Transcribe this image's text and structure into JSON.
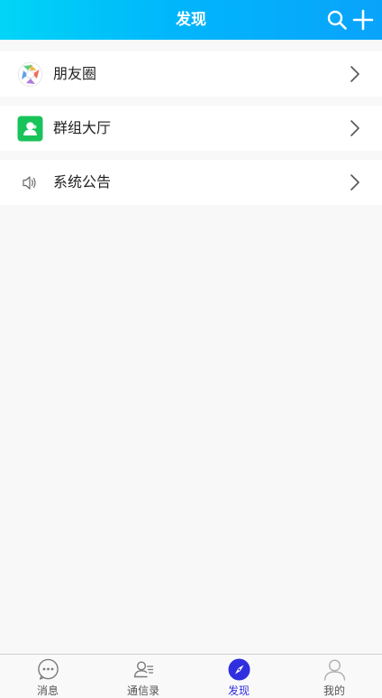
{
  "header": {
    "title": "发现",
    "search_icon": "search-icon",
    "add_icon": "plus-icon",
    "gradient": [
      "#00d5f7",
      "#0aa3fb"
    ]
  },
  "menu": {
    "items": [
      {
        "label": "朋友圈",
        "icon": "moments-aperture-icon"
      },
      {
        "label": "群组大厅",
        "icon": "group-hall-icon",
        "icon_color": "#18c35a"
      },
      {
        "label": "系统公告",
        "icon": "speaker-icon"
      }
    ],
    "chevron_icon": "chevron-right-icon"
  },
  "tabbar": {
    "tabs": [
      {
        "label": "消息",
        "icon": "chat-bubble-icon",
        "active": false
      },
      {
        "label": "通信录",
        "icon": "contacts-icon",
        "active": false
      },
      {
        "label": "发现",
        "icon": "compass-icon",
        "active": true
      },
      {
        "label": "我的",
        "icon": "person-icon",
        "active": false
      }
    ],
    "active_color": "#2f2fe0",
    "inactive_color": "#555555"
  }
}
